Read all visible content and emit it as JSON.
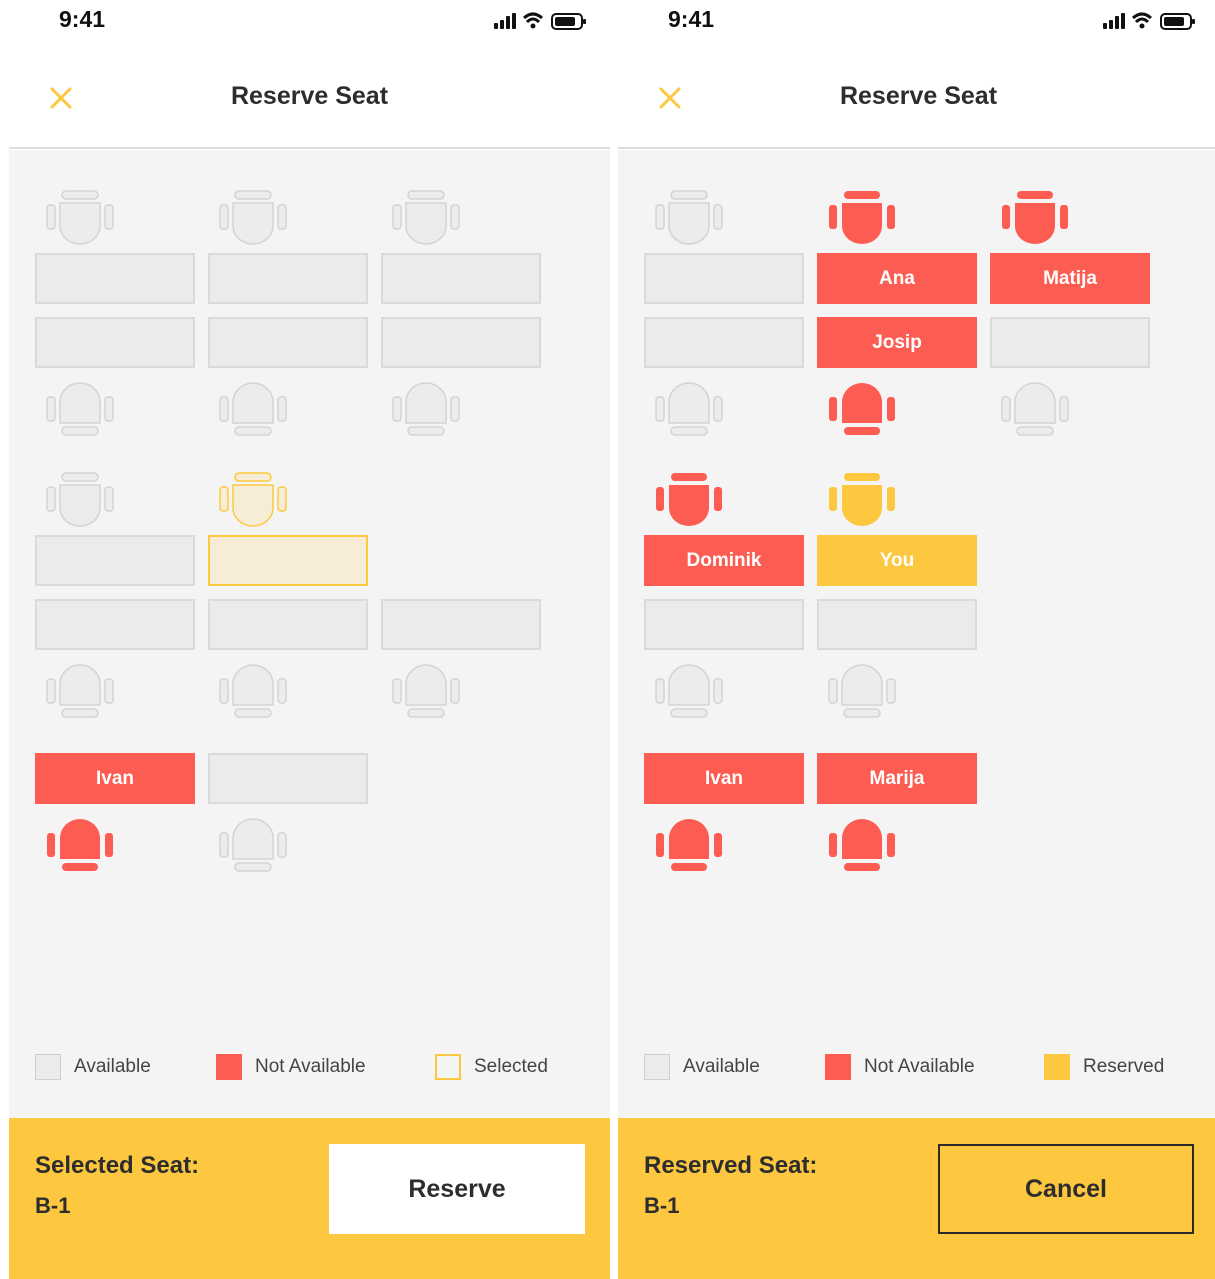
{
  "colors": {
    "accent_yellow": "#fdc83f",
    "not_available_red": "#fd5c52",
    "available_grey": "#ebebeb",
    "selected_fill": "#f7ecd6",
    "map_background": "#f4f4f4"
  },
  "screens": [
    {
      "status_time": "9:41",
      "title": "Reserve Seat",
      "close_icon": "close-x-icon",
      "legend": [
        {
          "label": "Available",
          "state": "available"
        },
        {
          "label": "Not Available",
          "state": "na"
        },
        {
          "label": "Selected",
          "state": "sel"
        }
      ],
      "footer": {
        "label": "Selected Seat:",
        "value": "B-1",
        "button": "Reserve"
      }
    },
    {
      "status_time": "9:41",
      "title": "Reserve Seat",
      "close_icon": "close-x-icon",
      "legend": [
        {
          "label": "Available",
          "state": "available"
        },
        {
          "label": "Not Available",
          "state": "na"
        },
        {
          "label": "Reserved",
          "state": "res"
        }
      ],
      "footer": {
        "label": "Reserved Seat:",
        "value": "B-1",
        "button": "Cancel"
      }
    }
  ],
  "left_desks": [
    {
      "state": "available",
      "name": ""
    },
    {
      "state": "available",
      "name": ""
    },
    {
      "state": "available",
      "name": ""
    },
    {
      "state": "available",
      "name": ""
    },
    {
      "state": "available",
      "name": ""
    },
    {
      "state": "available",
      "name": ""
    },
    {
      "state": "available",
      "name": ""
    },
    {
      "state": "sel",
      "name": ""
    },
    {
      "state": "available",
      "name": ""
    },
    {
      "state": "available",
      "name": ""
    },
    {
      "state": "available",
      "name": ""
    },
    {
      "state": "na",
      "name": "Ivan"
    },
    {
      "state": "available",
      "name": ""
    }
  ],
  "right_desks": [
    {
      "state": "available",
      "name": ""
    },
    {
      "state": "na",
      "name": "Ana"
    },
    {
      "state": "na",
      "name": "Matija"
    },
    {
      "state": "available",
      "name": ""
    },
    {
      "state": "na",
      "name": "Josip"
    },
    {
      "state": "available",
      "name": ""
    },
    {
      "state": "na",
      "name": "Dominik"
    },
    {
      "state": "you",
      "name": "You"
    },
    {
      "state": "available",
      "name": ""
    },
    {
      "state": "available",
      "name": ""
    },
    {
      "state": "na",
      "name": "Ivan"
    },
    {
      "state": "na",
      "name": "Marija"
    }
  ]
}
